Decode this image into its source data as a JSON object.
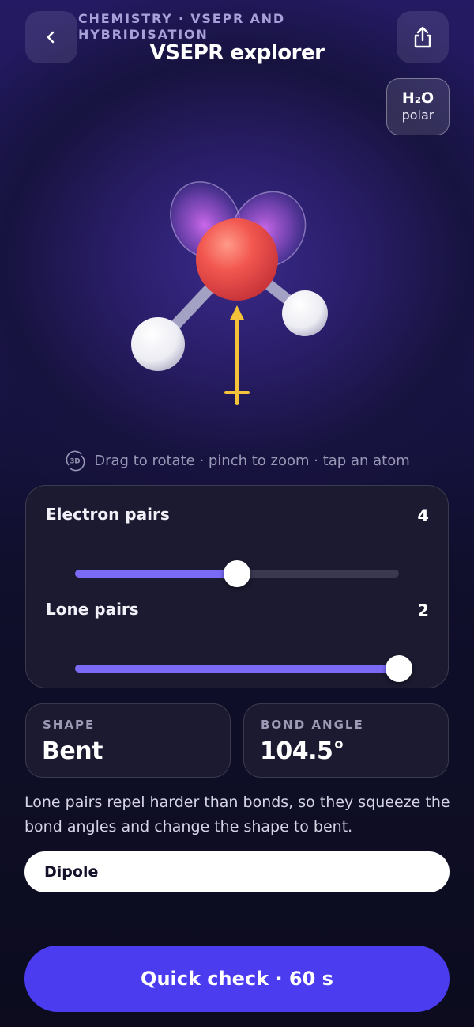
{
  "header": {
    "breadcrumb": "CHEMISTRY · VSEPR AND HYBRIDISATION",
    "title": "VSEPR explorer",
    "back_icon": "chevron-left-icon",
    "share_icon": "share-icon"
  },
  "molecule_badge": {
    "formula": "H₂O",
    "polarity": "polar"
  },
  "viewer": {
    "hint_icon": "rotate-3d-icon",
    "hint_icon_text": "3D",
    "hint": "Drag to rotate · pinch to zoom · tap an atom",
    "colors": {
      "central_atom": "#ee4b45",
      "lone_pair": "#c36ae0",
      "hydrogen": "#f0f0f6",
      "bond": "#a4a2c4",
      "dipole_arrow": "#f4c339"
    }
  },
  "sliders": [
    {
      "label": "Electron pairs",
      "value": "4",
      "fraction": 0.5
    },
    {
      "label": "Lone pairs",
      "value": "2",
      "fraction": 1.0
    }
  ],
  "stats": {
    "shape": {
      "label": "SHAPE",
      "value": "Bent"
    },
    "bond_angle": {
      "label": "BOND ANGLE",
      "value": "104.5°"
    }
  },
  "explanation": "Lone pairs repel harder than bonds, so they squeeze the bond angles and change the shape to bent.",
  "dipole_button": "Dipole",
  "cta": "Quick check · 60 s",
  "colors": {
    "accent": "#7a6af6",
    "cta": "#4b3cf0"
  }
}
